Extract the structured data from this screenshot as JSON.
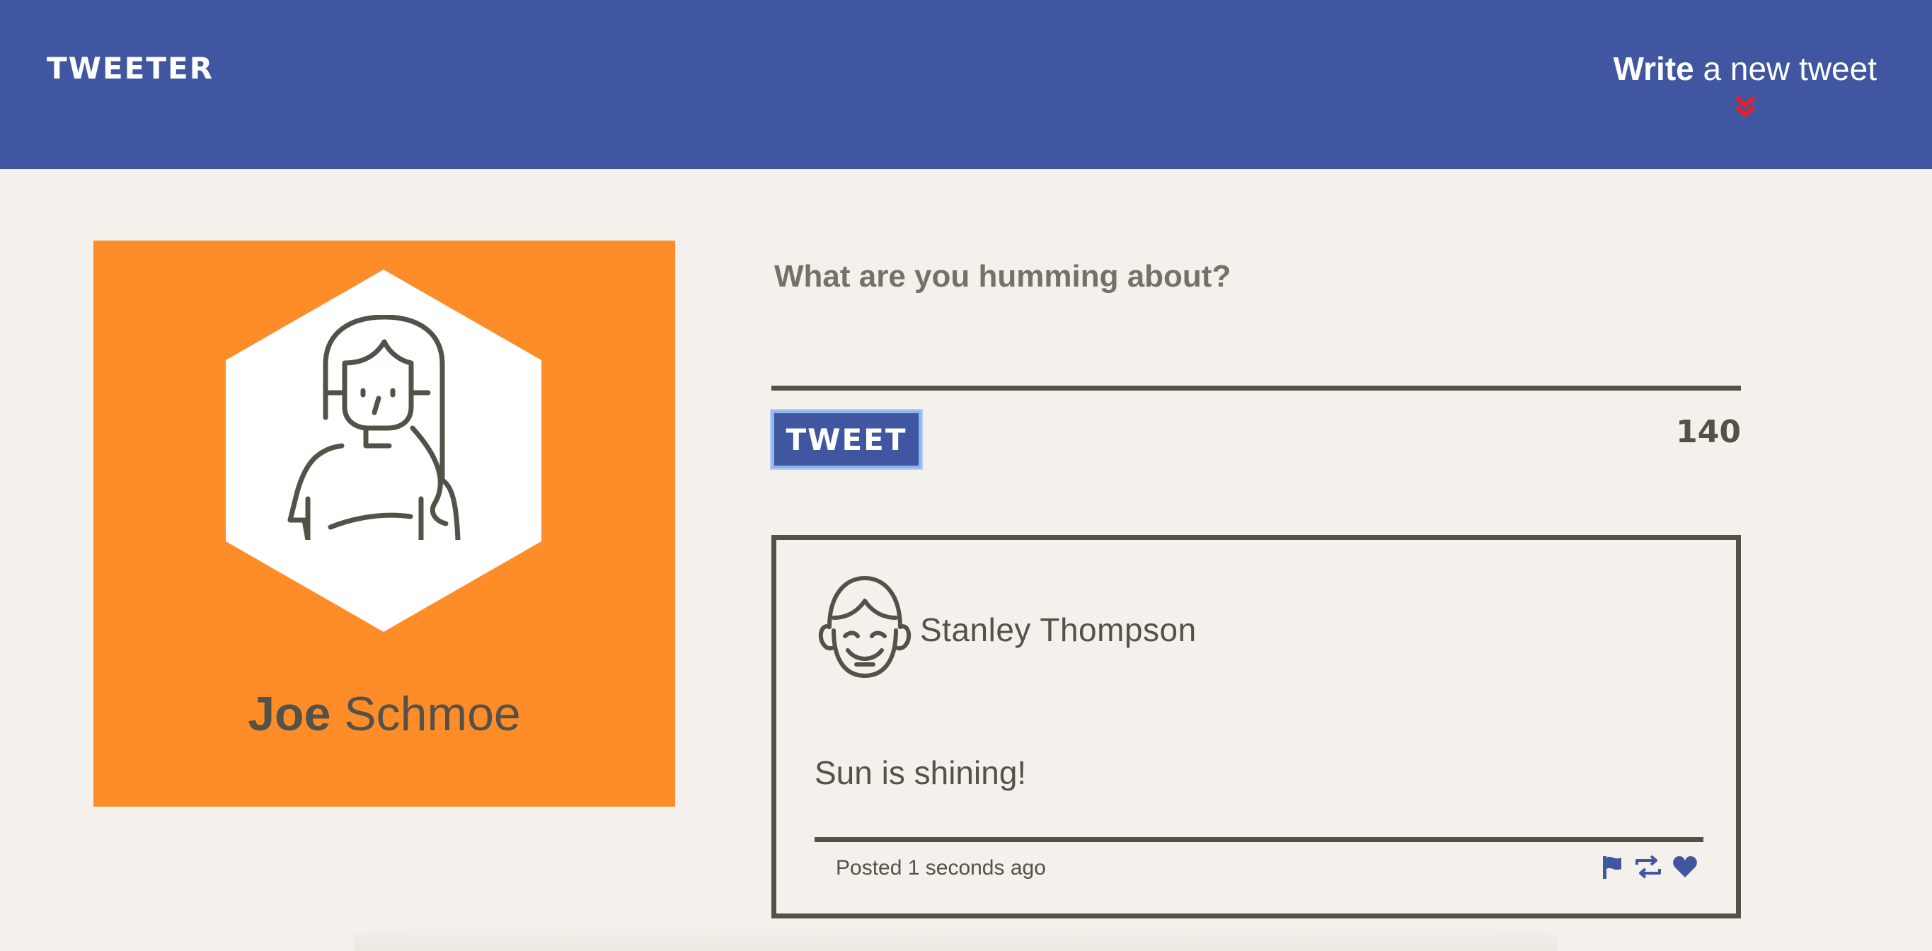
{
  "nav": {
    "brand": "TWEETER",
    "compose_strong": "Write",
    "compose_rest": " a new tweet",
    "compose_icon": "double-chevron-down-icon",
    "compose_icon_color": "#e8202a"
  },
  "profile": {
    "first_name": "Joe",
    "last_name": " Schmoe",
    "background_color": "#fe8d29",
    "avatar_icon": "woman-avatar-icon"
  },
  "composer": {
    "placeholder": "What are you humming about?",
    "button_label": "TWEET",
    "char_count": "140"
  },
  "tweet": {
    "author": "Stanley Thompson",
    "avatar_icon": "smiling-face-avatar-icon",
    "text": "Sun is shining!",
    "time": "Posted 1 seconds ago",
    "actions": [
      "flag-icon",
      "retweet-icon",
      "heart-icon"
    ]
  },
  "colors": {
    "nav_blue": "#4056a1",
    "background": "#f4f1ec",
    "ink": "#545149"
  }
}
